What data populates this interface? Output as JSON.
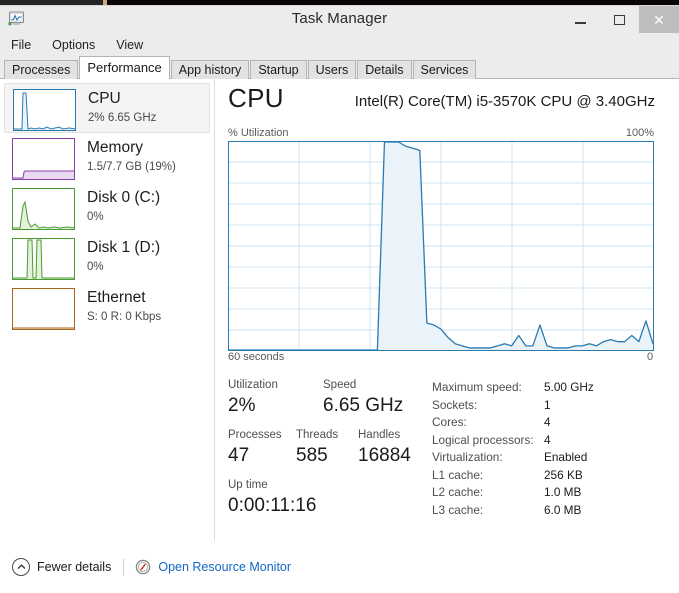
{
  "window": {
    "title": "Task Manager",
    "icon": "task-manager-icon",
    "controls": {
      "minimize": "–",
      "maximize": "□",
      "close": "✕"
    }
  },
  "menu": {
    "items": [
      {
        "label": "File"
      },
      {
        "label": "Options"
      },
      {
        "label": "View"
      }
    ]
  },
  "tabs": {
    "active": "Performance",
    "items": [
      {
        "label": "Processes"
      },
      {
        "label": "Performance"
      },
      {
        "label": "App history"
      },
      {
        "label": "Startup"
      },
      {
        "label": "Users"
      },
      {
        "label": "Details"
      },
      {
        "label": "Services"
      }
    ]
  },
  "sidebar": {
    "items": [
      {
        "title": "CPU",
        "sub": "2% 6.65 GHz",
        "color": "#2a7ab0",
        "fill": "#eaf3fa",
        "selected": true,
        "spark": "0,40 6,40 9,40 10,4 13,4 15,40 18,39 22,40 26,39 30,40 34,38 38,40 42,39 46,38 50,40 56,39 63,40"
      },
      {
        "title": "Memory",
        "sub": "1.5/7.7 GB (19%)",
        "color": "#8b3fa8",
        "fill": "#ead9f2",
        "selected": false,
        "spark": "0,40 11,40 12,34 13,33 30,33 45,33 63,33"
      },
      {
        "title": "Disk 0 (C:)",
        "sub": "0%",
        "color": "#4a9b2f",
        "fill": "#e4f2dc",
        "selected": false,
        "spark": "0,40 8,40 11,18 13,14 16,33 19,39 23,36 27,40 32,39 36,40 42,39 48,40 55,39 63,40"
      },
      {
        "title": "Disk 1 (D:)",
        "sub": "0%",
        "color": "#4a9b2f",
        "fill": "#e4f2dc",
        "selected": false,
        "spark": "0,40 15,40 16,2 20,2 21,40 24,40 25,2 29,2 30,40 40,40 63,40"
      },
      {
        "title": "Ethernet",
        "sub": "S: 0 R: 0 Kbps",
        "color": "#a8651c",
        "fill": "#f7ead9",
        "selected": false,
        "spark": "0,40 63,40"
      }
    ]
  },
  "main": {
    "heading": "CPU",
    "model": "Intel(R) Core(TM) i5-3570K CPU @ 3.40GHz",
    "chart_axis_top_label": "% Utilization",
    "chart_axis_top_right": "100%",
    "chart_axis_left": "60 seconds",
    "chart_axis_right": "0",
    "stats": {
      "utilization_label": "Utilization",
      "utilization_value": "2%",
      "speed_label": "Speed",
      "speed_value": "6.65 GHz",
      "processes_label": "Processes",
      "processes_value": "47",
      "threads_label": "Threads",
      "threads_value": "585",
      "handles_label": "Handles",
      "handles_value": "16884",
      "uptime_label": "Up time",
      "uptime_value": "0:00:11:16"
    },
    "specs": [
      {
        "label": "Maximum speed:",
        "value": "5.00 GHz"
      },
      {
        "label": "Sockets:",
        "value": "1"
      },
      {
        "label": "Cores:",
        "value": "4"
      },
      {
        "label": "Logical processors:",
        "value": "4"
      },
      {
        "label": "Virtualization:",
        "value": "Enabled"
      },
      {
        "label": "L1 cache:",
        "value": "256 KB"
      },
      {
        "label": "L2 cache:",
        "value": "1.0 MB"
      },
      {
        "label": "L3 cache:",
        "value": "6.0 MB"
      }
    ]
  },
  "footer": {
    "fewer_details_label": "Fewer details",
    "fewer_details_icon": "chevron-up-circle-icon",
    "resource_monitor_label": "Open Resource Monitor",
    "resource_monitor_icon": "resource-monitor-icon",
    "link_color": "#1266c4"
  },
  "chart_data": {
    "type": "area",
    "title": "CPU % Utilization",
    "xlabel": "60 seconds",
    "ylabel": "% Utilization",
    "ylim": [
      0,
      100
    ],
    "xlim": [
      60,
      0
    ],
    "grid": true,
    "grid_rows": 10,
    "grid_cols": 6,
    "line_color": "#2a7ab0",
    "fill_color": "#eaf3fa",
    "legend": "none",
    "x": [
      60,
      59,
      58,
      57,
      56,
      55,
      54,
      53,
      52,
      51,
      50,
      49,
      48,
      47,
      46,
      45,
      44,
      43,
      42,
      41,
      40,
      39,
      38,
      37,
      36,
      35,
      34,
      33,
      32,
      31,
      30,
      29,
      28,
      27,
      26,
      25,
      24,
      23,
      22,
      21,
      20,
      19,
      18,
      17,
      16,
      15,
      14,
      13,
      12,
      11,
      10,
      9,
      8,
      7,
      6,
      5,
      4,
      3,
      2,
      1,
      0
    ],
    "values": [
      0,
      0,
      0,
      0,
      0,
      0,
      0,
      0,
      0,
      0,
      0,
      0,
      0,
      0,
      0,
      0,
      0,
      0,
      0,
      0,
      0,
      0,
      100,
      100,
      100,
      98,
      97,
      96,
      13,
      12,
      10,
      6,
      3,
      2,
      1,
      1,
      1,
      1,
      2,
      3,
      2,
      7,
      2,
      2,
      12,
      2,
      1,
      1,
      1,
      2,
      2,
      3,
      2,
      4,
      5,
      4,
      4,
      7,
      4,
      14,
      3
    ]
  }
}
